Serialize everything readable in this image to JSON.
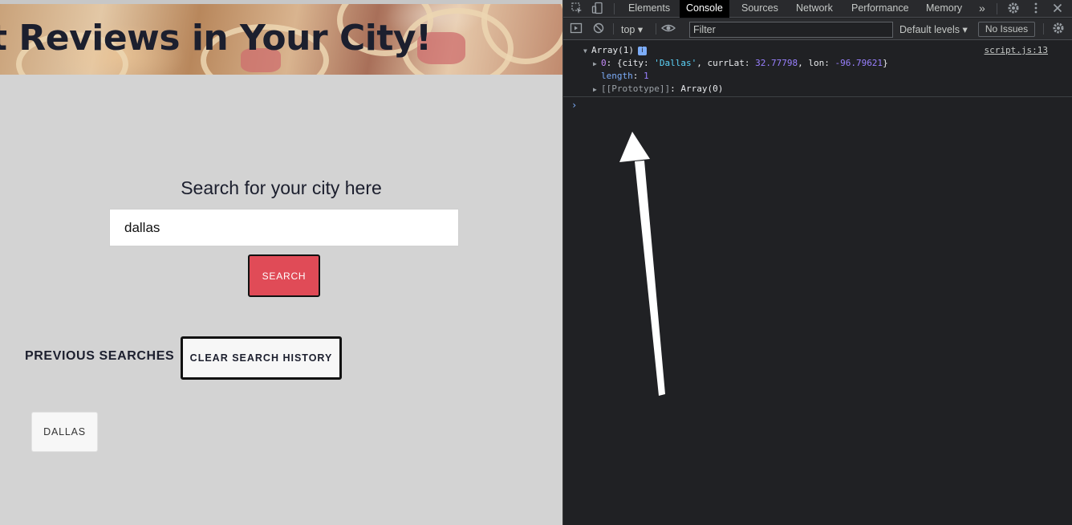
{
  "page": {
    "hero_title": "t Reviews in Your City!",
    "search_label": "Search for your city here",
    "search_input_value": "dallas",
    "search_button_label": "SEARCH",
    "previous_searches_label": "PREVIOUS SEARCHES",
    "clear_history_label": "CLEAR SEARCH HISTORY",
    "history_items": [
      "DALLAS"
    ]
  },
  "devtools": {
    "tabs": [
      "Elements",
      "Console",
      "Sources",
      "Network",
      "Performance",
      "Memory"
    ],
    "active_tab": "Console",
    "more_tabs": "»",
    "context": "top",
    "filter_placeholder": "Filter",
    "levels_label": "Default levels",
    "issues_label": "No Issues",
    "console": {
      "source_link": "script.js:13",
      "array_header": "Array(1)",
      "info_icon": "i",
      "row0_index": "0",
      "row0_city_key": "city",
      "row0_city_value": "'Dallas'",
      "row0_lat_key": "currLat",
      "row0_lat_value": "32.77798",
      "row0_lon_key": "lon",
      "row0_lon_value": "-96.79621",
      "length_key": "length",
      "length_value": "1",
      "prototype_key": "[[Prototype]]",
      "prototype_value": "Array(0)",
      "prompt": "›"
    }
  },
  "colors": {
    "search_button": "#e04b57",
    "page_background": "#d3d3d3",
    "devtools_background": "#202124",
    "annotation_arrow": "#ffffff"
  },
  "annotation": {
    "type": "arrow",
    "icon": "arrow-up-icon"
  }
}
